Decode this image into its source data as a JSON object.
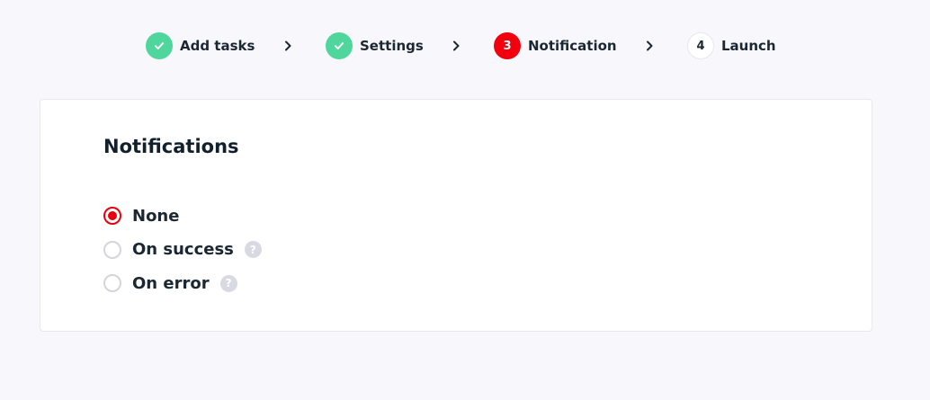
{
  "stepper": {
    "steps": [
      {
        "label": "Add tasks",
        "status": "completed",
        "icon": "check-icon"
      },
      {
        "label": "Settings",
        "status": "completed",
        "icon": "check-icon"
      },
      {
        "label": "Notification",
        "status": "active",
        "number": "3"
      },
      {
        "label": "Launch",
        "status": "pending",
        "number": "4"
      }
    ],
    "separator_icon": "chevron-right-icon"
  },
  "notifications": {
    "title": "Notifications",
    "options": [
      {
        "label": "None",
        "selected": true,
        "has_help": false
      },
      {
        "label": "On success",
        "selected": false,
        "has_help": true,
        "help_symbol": "?"
      },
      {
        "label": "On error",
        "selected": false,
        "has_help": true,
        "help_symbol": "?"
      }
    ]
  },
  "colors": {
    "background": "#f8f8fc",
    "completed": "#4fd69c",
    "active": "#f2000d",
    "radio_selected": "#e8000c",
    "text": "#1b2733",
    "help_icon_bg": "#d9d9e3"
  }
}
